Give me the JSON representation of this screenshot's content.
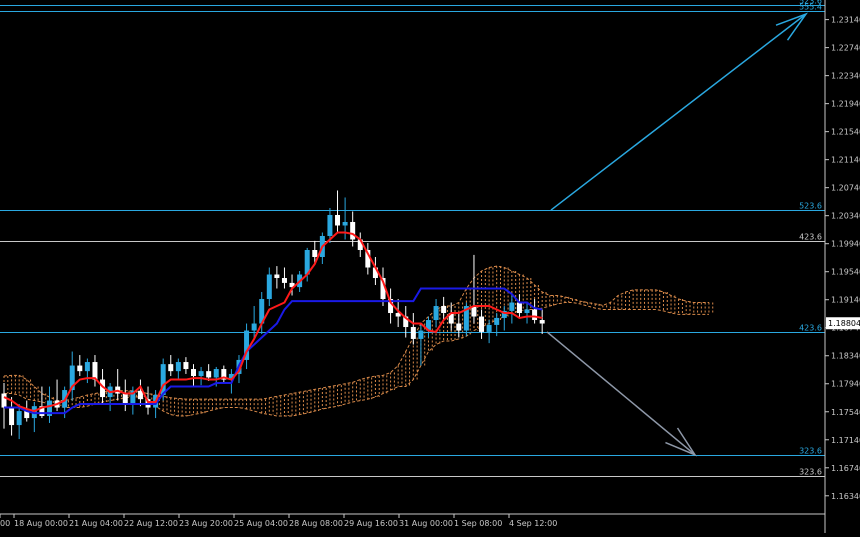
{
  "chart_data": {
    "type": "candlestick",
    "symbol_hint": "EURUSD",
    "y_axis": {
      "ticks": [
        "1.23140",
        "1.22740",
        "1.22340",
        "1.21940",
        "1.21540",
        "1.21140",
        "1.20740",
        "1.20340",
        "1.19940",
        "1.19540",
        "1.19140",
        "1.18740",
        "1.18340",
        "1.17940",
        "1.17540",
        "1.17140",
        "1.16740",
        "1.16340"
      ],
      "range": [
        1.1608,
        1.2342
      ],
      "current_price": "1.18804"
    },
    "x_axis": {
      "labels": [
        "00",
        "18 Aug 00:00",
        "21 Aug 04:00",
        "22 Aug 12:00",
        "23 Aug 20:00",
        "25 Aug 04:00",
        "28 Aug 08:00",
        "29 Aug 16:00",
        "31 Aug 00:00",
        "1 Sep 08:00",
        "4 Sep 12:00"
      ]
    },
    "fib_levels": [
      {
        "label": "523.6",
        "price": 1.2335,
        "color": "#2aa8e0"
      },
      {
        "label": "555.4",
        "price": 1.2327,
        "color": "#2aa8e0"
      },
      {
        "label": "523.6",
        "price": 1.2042,
        "color": "#2aa8e0"
      },
      {
        "label": "423.6",
        "price": 1.19985,
        "color": "#c8c8c8"
      },
      {
        "label": "423.6",
        "price": 1.1868,
        "color": "#2aa8e0"
      },
      {
        "label": "323.6",
        "price": 1.16925,
        "color": "#2aa8e0"
      },
      {
        "label": "323.6",
        "price": 1.1662,
        "color": "#c8c8c8"
      }
    ],
    "candles": [
      [
        1.178,
        1.1795,
        1.173,
        1.176
      ],
      [
        1.176,
        1.1775,
        1.172,
        1.1735
      ],
      [
        1.1735,
        1.1765,
        1.1715,
        1.1755
      ],
      [
        1.1755,
        1.177,
        1.174,
        1.1745
      ],
      [
        1.1745,
        1.1768,
        1.1725,
        1.1762
      ],
      [
        1.1762,
        1.179,
        1.1745,
        1.1748
      ],
      [
        1.1748,
        1.179,
        1.1738,
        1.177
      ],
      [
        1.177,
        1.18,
        1.1755,
        1.176
      ],
      [
        1.176,
        1.179,
        1.1745,
        1.1785
      ],
      [
        1.1785,
        1.184,
        1.177,
        1.182
      ],
      [
        1.182,
        1.1835,
        1.1805,
        1.1812
      ],
      [
        1.1812,
        1.183,
        1.1795,
        1.1825
      ],
      [
        1.1825,
        1.1835,
        1.179,
        1.18
      ],
      [
        1.18,
        1.1815,
        1.1765,
        1.1775
      ],
      [
        1.1775,
        1.1795,
        1.1755,
        1.179
      ],
      [
        1.179,
        1.1815,
        1.177,
        1.178
      ],
      [
        1.178,
        1.18,
        1.1755,
        1.1765
      ],
      [
        1.1765,
        1.179,
        1.175,
        1.1784
      ],
      [
        1.1784,
        1.18,
        1.1762,
        1.1772
      ],
      [
        1.1772,
        1.179,
        1.175,
        1.176
      ],
      [
        1.176,
        1.1785,
        1.1745,
        1.1778
      ],
      [
        1.1778,
        1.183,
        1.177,
        1.1822
      ],
      [
        1.1822,
        1.1835,
        1.1805,
        1.1812
      ],
      [
        1.1812,
        1.183,
        1.18,
        1.1825
      ],
      [
        1.1825,
        1.1832,
        1.1808,
        1.1815
      ],
      [
        1.1815,
        1.1822,
        1.179,
        1.1805
      ],
      [
        1.1805,
        1.1818,
        1.1792,
        1.1812
      ],
      [
        1.1812,
        1.1822,
        1.1798,
        1.1803
      ],
      [
        1.1803,
        1.1818,
        1.179,
        1.1815
      ],
      [
        1.1815,
        1.182,
        1.1795,
        1.18
      ],
      [
        1.18,
        1.1815,
        1.178,
        1.1808
      ],
      [
        1.1808,
        1.1835,
        1.1795,
        1.1828
      ],
      [
        1.1828,
        1.188,
        1.1815,
        1.187
      ],
      [
        1.187,
        1.1905,
        1.1858,
        1.188
      ],
      [
        1.188,
        1.1925,
        1.1865,
        1.1915
      ],
      [
        1.1915,
        1.196,
        1.1905,
        1.195
      ],
      [
        1.195,
        1.1962,
        1.193,
        1.1945
      ],
      [
        1.1945,
        1.196,
        1.193,
        1.1938
      ],
      [
        1.1938,
        1.195,
        1.192,
        1.1932
      ],
      [
        1.1932,
        1.1955,
        1.1925,
        1.195
      ],
      [
        1.195,
        1.1988,
        1.194,
        1.1985
      ],
      [
        1.1985,
        1.1998,
        1.1965,
        1.1975
      ],
      [
        1.1975,
        1.201,
        1.1965,
        1.2005
      ],
      [
        1.2005,
        1.2045,
        1.1995,
        1.2035
      ],
      [
        1.2035,
        1.207,
        1.201,
        1.202
      ],
      [
        1.202,
        1.206,
        1.2,
        1.2025
      ],
      [
        1.2025,
        1.204,
        1.199,
        1.2
      ],
      [
        1.2,
        1.201,
        1.1975,
        1.1985
      ],
      [
        1.1985,
        1.1995,
        1.195,
        1.196
      ],
      [
        1.196,
        1.1975,
        1.1935,
        1.1945
      ],
      [
        1.1945,
        1.196,
        1.1905,
        1.1915
      ],
      [
        1.1915,
        1.193,
        1.188,
        1.1895
      ],
      [
        1.1895,
        1.1915,
        1.1875,
        1.189
      ],
      [
        1.189,
        1.1905,
        1.186,
        1.1875
      ],
      [
        1.1875,
        1.1895,
        1.185,
        1.1858
      ],
      [
        1.1858,
        1.188,
        1.182,
        1.187
      ],
      [
        1.187,
        1.189,
        1.186,
        1.1885
      ],
      [
        1.1885,
        1.1915,
        1.1875,
        1.1905
      ],
      [
        1.1905,
        1.1918,
        1.1885,
        1.1895
      ],
      [
        1.1895,
        1.191,
        1.187,
        1.188
      ],
      [
        1.188,
        1.1895,
        1.186,
        1.187
      ],
      [
        1.187,
        1.191,
        1.1862,
        1.1905
      ],
      [
        1.1905,
        1.1978,
        1.188,
        1.189
      ],
      [
        1.189,
        1.19,
        1.1858,
        1.1868
      ],
      [
        1.1868,
        1.1885,
        1.1852,
        1.1878
      ],
      [
        1.1878,
        1.1895,
        1.1862,
        1.1888
      ],
      [
        1.1888,
        1.1905,
        1.187,
        1.1898
      ],
      [
        1.1898,
        1.192,
        1.188,
        1.191
      ],
      [
        1.191,
        1.1922,
        1.1888,
        1.1895
      ],
      [
        1.1895,
        1.1908,
        1.188,
        1.19
      ],
      [
        1.19,
        1.1915,
        1.188,
        1.1885
      ],
      [
        1.1885,
        1.19,
        1.1865,
        1.188
      ]
    ],
    "tenkan": [
      1.1775,
      1.177,
      1.1762,
      1.1758,
      1.1755,
      1.176,
      1.1762,
      1.1765,
      1.177,
      1.179,
      1.18,
      1.1802,
      1.1802,
      1.179,
      1.1782,
      1.1784,
      1.178,
      1.178,
      1.179,
      1.1768,
      1.1768,
      1.1792,
      1.18,
      1.18,
      1.18,
      1.1802,
      1.1802,
      1.18,
      1.18,
      1.1803,
      1.18,
      1.1812,
      1.184,
      1.1858,
      1.188,
      1.19,
      1.1905,
      1.191,
      1.193,
      1.194,
      1.195,
      1.1965,
      1.199,
      1.2,
      1.201,
      1.201,
      1.2008,
      1.2,
      1.198,
      1.196,
      1.194,
      1.191,
      1.1898,
      1.1888,
      1.188,
      1.188,
      1.187,
      1.1868,
      1.1885,
      1.1895,
      1.1895,
      1.19,
      1.1905,
      1.1905,
      1.1905,
      1.19,
      1.1895,
      1.1895,
      1.1888,
      1.189,
      1.189,
      1.1888
    ],
    "kijun": [
      1.176,
      1.176,
      1.176,
      1.1755,
      1.1752,
      1.1752,
      1.1752,
      1.1752,
      1.1752,
      1.176,
      1.1765,
      1.1765,
      1.1765,
      1.1765,
      1.1765,
      1.1765,
      1.1765,
      1.1765,
      1.1765,
      1.1765,
      1.1765,
      1.178,
      1.179,
      1.179,
      1.179,
      1.179,
      1.179,
      1.179,
      1.1795,
      1.1795,
      1.1795,
      1.182,
      1.184,
      1.185,
      1.186,
      1.187,
      1.188,
      1.19,
      1.1912,
      1.1912,
      1.1912,
      1.1912,
      1.1912,
      1.1912,
      1.1912,
      1.1912,
      1.1912,
      1.1912,
      1.1912,
      1.1912,
      1.1912,
      1.1912,
      1.1912,
      1.1912,
      1.1912,
      1.193,
      1.193,
      1.193,
      1.193,
      1.193,
      1.193,
      1.193,
      1.193,
      1.193,
      1.193,
      1.193,
      1.193,
      1.1922,
      1.191,
      1.191,
      1.1902,
      1.19
    ],
    "cloud": {
      "top": [
        1.1805,
        1.1806,
        1.1806,
        1.18,
        1.179,
        1.178,
        1.1775,
        1.177,
        1.177,
        1.1772,
        1.1775,
        1.1778,
        1.178,
        1.1782,
        1.1784,
        1.1784,
        1.1784,
        1.1784,
        1.1782,
        1.178,
        1.1778,
        1.1776,
        1.1774,
        1.1773,
        1.1772,
        1.1772,
        1.1772,
        1.1772,
        1.1772,
        1.1772,
        1.1772,
        1.1772,
        1.1772,
        1.1772,
        1.1772,
        1.1774,
        1.1776,
        1.1778,
        1.178,
        1.1782,
        1.1784,
        1.1786,
        1.1788,
        1.179,
        1.1792,
        1.1794,
        1.1796,
        1.18,
        1.1803,
        1.1805,
        1.1806,
        1.181,
        1.182,
        1.184,
        1.186,
        1.188,
        1.189,
        1.19,
        1.1905,
        1.1905,
        1.191,
        1.193,
        1.1945,
        1.1955,
        1.196,
        1.1962,
        1.196,
        1.1955,
        1.195,
        1.1945,
        1.1935,
        1.1925,
        1.192,
        1.192,
        1.1918,
        1.1915,
        1.1912,
        1.191,
        1.1908,
        1.1906,
        1.191,
        1.192,
        1.1925,
        1.1928,
        1.1928,
        1.1928,
        1.1928,
        1.1925,
        1.192,
        1.1915,
        1.1912,
        1.191,
        1.191,
        1.191
      ],
      "bottom": [
        1.178,
        1.178,
        1.1778,
        1.1772,
        1.177,
        1.1768,
        1.1765,
        1.1762,
        1.176,
        1.176,
        1.176,
        1.1762,
        1.1765,
        1.1768,
        1.177,
        1.1772,
        1.1774,
        1.1775,
        1.1775,
        1.177,
        1.1762,
        1.1755,
        1.175,
        1.1748,
        1.1748,
        1.175,
        1.1752,
        1.1755,
        1.1758,
        1.176,
        1.176,
        1.176,
        1.1758,
        1.1755,
        1.1752,
        1.175,
        1.1748,
        1.1748,
        1.1748,
        1.175,
        1.1752,
        1.1755,
        1.1758,
        1.176,
        1.1762,
        1.1765,
        1.1768,
        1.177,
        1.1772,
        1.1775,
        1.178,
        1.1785,
        1.179,
        1.179,
        1.18,
        1.182,
        1.184,
        1.185,
        1.1855,
        1.1855,
        1.1858,
        1.1862,
        1.187,
        1.1875,
        1.188,
        1.1885,
        1.189,
        1.1895,
        1.1898,
        1.19,
        1.19,
        1.1902,
        1.1905,
        1.1908,
        1.191,
        1.191,
        1.1908,
        1.1905,
        1.1902,
        1.19,
        1.19,
        1.19,
        1.19,
        1.19,
        1.19,
        1.19,
        1.19,
        1.1898,
        1.1895,
        1.1893,
        1.1893,
        1.1893,
        1.1893,
        1.1893
      ]
    },
    "projections": [
      {
        "from": [
          1.2042,
          1.2322
        ],
        "color": "#2aa8e0"
      },
      {
        "from": [
          1.1868,
          1.16925
        ],
        "color": "#8e98a8"
      }
    ],
    "colors": {
      "background": "#000000",
      "grid": "#1a1a1a",
      "bull_candle": "#2aa8e0",
      "bear_candle": "#ffffff",
      "tenkan": "#ff1a1a",
      "kijun": "#1a1ae6",
      "cloud": "#d98a4a",
      "axis_text": "#c8c8c8",
      "price_tag_bg": "#ffffff",
      "price_tag_text": "#000000"
    }
  }
}
